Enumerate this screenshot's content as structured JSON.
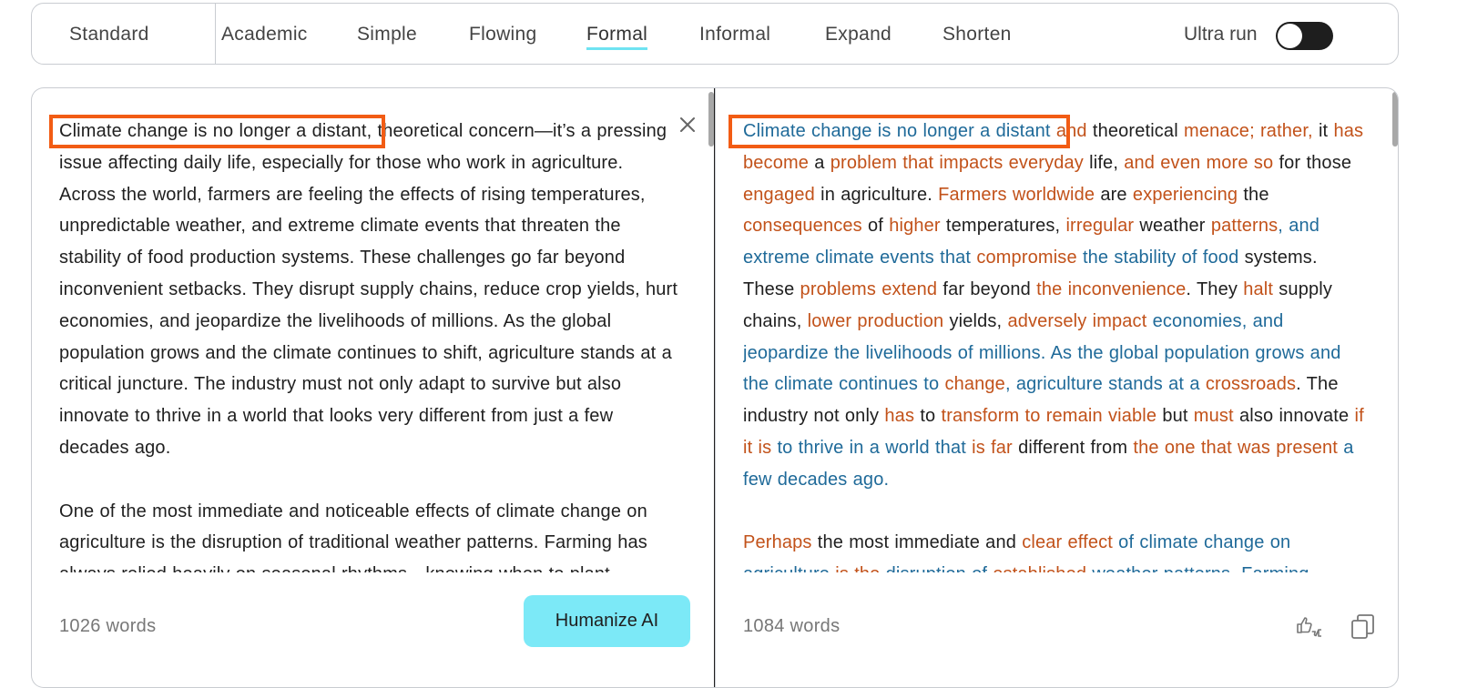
{
  "modes": {
    "standard": "Standard",
    "academic": "Academic",
    "simple": "Simple",
    "flowing": "Flowing",
    "formal": "Formal",
    "informal": "Informal",
    "expand": "Expand",
    "shorten": "Shorten",
    "active": "Formal"
  },
  "ultra_run": {
    "label": "Ultra run",
    "enabled": false
  },
  "input": {
    "paragraphs": [
      "Climate change is no longer a distant, theoretical concern—it’s a pressing issue affecting daily life, especially for those who work in agriculture. Across the world, farmers are feeling the effects of rising temperatures, unpredictable weather, and extreme climate events that threaten the stability of food production systems. These challenges go far beyond inconvenient setbacks. They disrupt supply chains, reduce crop yields, hurt economies, and jeopardize the livelihoods of millions. As the global population grows and the climate continues to shift, agriculture stands at a critical juncture. The industry must not only adapt to survive but also innovate to thrive in a world that looks very different from just a few decades ago.",
      "One of the most immediate and noticeable effects of climate change on agriculture is the disruption of traditional weather patterns. Farming has always relied heavily on seasonal rhythms—knowing when to plant"
    ],
    "word_count": "1026 words",
    "submit_label": "Humanize AI",
    "clear_icon": "close-icon"
  },
  "output": {
    "paragraphs": [
      [
        {
          "t": "Climate change is no longer a distant ",
          "c": "kept"
        },
        {
          "t": "and",
          "c": "changed"
        },
        {
          "t": " theoretical ",
          "c": "plain"
        },
        {
          "t": "menace; rather,",
          "c": "changed"
        },
        {
          "t": " it ",
          "c": "plain"
        },
        {
          "t": "has become",
          "c": "changed"
        },
        {
          "t": " a ",
          "c": "plain"
        },
        {
          "t": "problem that impacts everyday",
          "c": "changed"
        },
        {
          "t": " life, ",
          "c": "plain"
        },
        {
          "t": "and even more so",
          "c": "changed"
        },
        {
          "t": " for those ",
          "c": "plain"
        },
        {
          "t": "engaged",
          "c": "changed"
        },
        {
          "t": " in agriculture. ",
          "c": "plain"
        },
        {
          "t": "Farmers worldwide",
          "c": "changed"
        },
        {
          "t": " are ",
          "c": "plain"
        },
        {
          "t": "experiencing",
          "c": "changed"
        },
        {
          "t": " the ",
          "c": "plain"
        },
        {
          "t": "consequences",
          "c": "changed"
        },
        {
          "t": " of ",
          "c": "plain"
        },
        {
          "t": "higher",
          "c": "changed"
        },
        {
          "t": " temperatures, ",
          "c": "plain"
        },
        {
          "t": "irregular",
          "c": "changed"
        },
        {
          "t": " weather ",
          "c": "plain"
        },
        {
          "t": "patterns",
          "c": "changed"
        },
        {
          "t": ", and extreme climate events that ",
          "c": "kept"
        },
        {
          "t": "compromise",
          "c": "changed"
        },
        {
          "t": " the stability of food",
          "c": "kept"
        },
        {
          "t": " systems. These ",
          "c": "plain"
        },
        {
          "t": "problems extend",
          "c": "changed"
        },
        {
          "t": " far beyond ",
          "c": "plain"
        },
        {
          "t": "the inconvenience",
          "c": "changed"
        },
        {
          "t": ". They ",
          "c": "plain"
        },
        {
          "t": "halt",
          "c": "changed"
        },
        {
          "t": " supply chains, ",
          "c": "plain"
        },
        {
          "t": "lower production",
          "c": "changed"
        },
        {
          "t": " yields, ",
          "c": "plain"
        },
        {
          "t": "adversely impact",
          "c": "changed"
        },
        {
          "t": " economies, and jeopardize the livelihoods of millions. As the global population grows and the climate continues to ",
          "c": "kept"
        },
        {
          "t": "change",
          "c": "changed"
        },
        {
          "t": ", agriculture stands at a ",
          "c": "kept"
        },
        {
          "t": "crossroads",
          "c": "changed"
        },
        {
          "t": ". The industry not only ",
          "c": "plain"
        },
        {
          "t": "has",
          "c": "changed"
        },
        {
          "t": " to ",
          "c": "plain"
        },
        {
          "t": "transform to remain viable",
          "c": "changed"
        },
        {
          "t": " but ",
          "c": "plain"
        },
        {
          "t": "must",
          "c": "changed"
        },
        {
          "t": " also innovate ",
          "c": "plain"
        },
        {
          "t": "if it is",
          "c": "changed"
        },
        {
          "t": " to thrive in a world that ",
          "c": "kept"
        },
        {
          "t": "is far",
          "c": "changed"
        },
        {
          "t": " different from ",
          "c": "plain"
        },
        {
          "t": "the one that was present",
          "c": "changed"
        },
        {
          "t": " a few decades ago.",
          "c": "kept"
        }
      ],
      [
        {
          "t": "Perhaps",
          "c": "changed"
        },
        {
          "t": " the most immediate and ",
          "c": "plain"
        },
        {
          "t": "clear effect",
          "c": "changed"
        },
        {
          "t": " of climate change on ",
          "c": "kept"
        },
        {
          "t": "agriculture",
          "c": "kept"
        },
        {
          "t": " is the ",
          "c": "changed"
        },
        {
          "t": "disruption of ",
          "c": "kept"
        },
        {
          "t": "established",
          "c": "changed"
        },
        {
          "t": " weather patterns. Farming",
          "c": "kept"
        }
      ]
    ],
    "word_count": "1084 words",
    "feedback_icon": "thumbs-up-down-icon",
    "copy_icon": "copy-icon"
  },
  "colors": {
    "changed": "#c2521a",
    "kept": "#1f6a99",
    "highlight_box": "#f25c14",
    "active_underline": "#6fe3f2",
    "humanize_button": "#7ce9f7"
  }
}
